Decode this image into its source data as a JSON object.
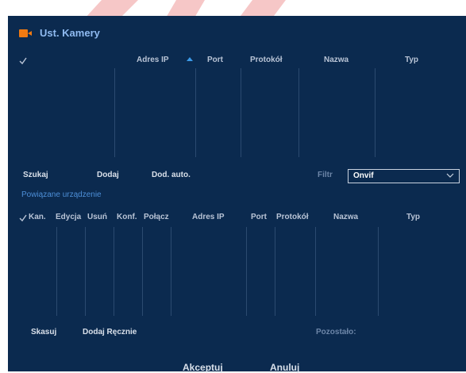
{
  "window": {
    "title": "Ust. Kamery",
    "icon": "camera-icon"
  },
  "top_table": {
    "check_icon": "checkmark-icon",
    "headers": {
      "ip": "Adres IP",
      "port": "Port",
      "protocol": "Protokół",
      "name": "Nazwa",
      "type": "Typ"
    },
    "sort_icon": "sort-up-arrow-icon",
    "rows": []
  },
  "top_actions": {
    "search": "Szukaj",
    "add": "Dodaj",
    "auto_add": "Dod. auto."
  },
  "filter": {
    "label": "Filtr",
    "value": "Onvif",
    "icon": "chevron-down-icon"
  },
  "bound_section": {
    "title": "Powiązane urządzenie"
  },
  "bottom_table": {
    "check_icon": "checkmark-icon",
    "headers": {
      "ch": "Kan.",
      "edit": "Edycja",
      "delete": "Usuń",
      "conf": "Konf.",
      "connect": "Połącz",
      "ip": "Adres IP",
      "port": "Port",
      "protocol": "Protokół",
      "name": "Nazwa",
      "type": "Typ"
    },
    "rows": []
  },
  "bottom_actions": {
    "delete": "Skasuj",
    "manual_add": "Dodaj Ręcznie",
    "remaining_label": "Pozostało:"
  },
  "dialog_actions": {
    "accept": "Akceptuj",
    "cancel": "Anuluj"
  },
  "colors": {
    "panel": "#0b2a4f",
    "accent": "#f07a12",
    "title": "#8fbaf0",
    "link": "#4d8fd8",
    "sort": "#3b9ae8"
  }
}
